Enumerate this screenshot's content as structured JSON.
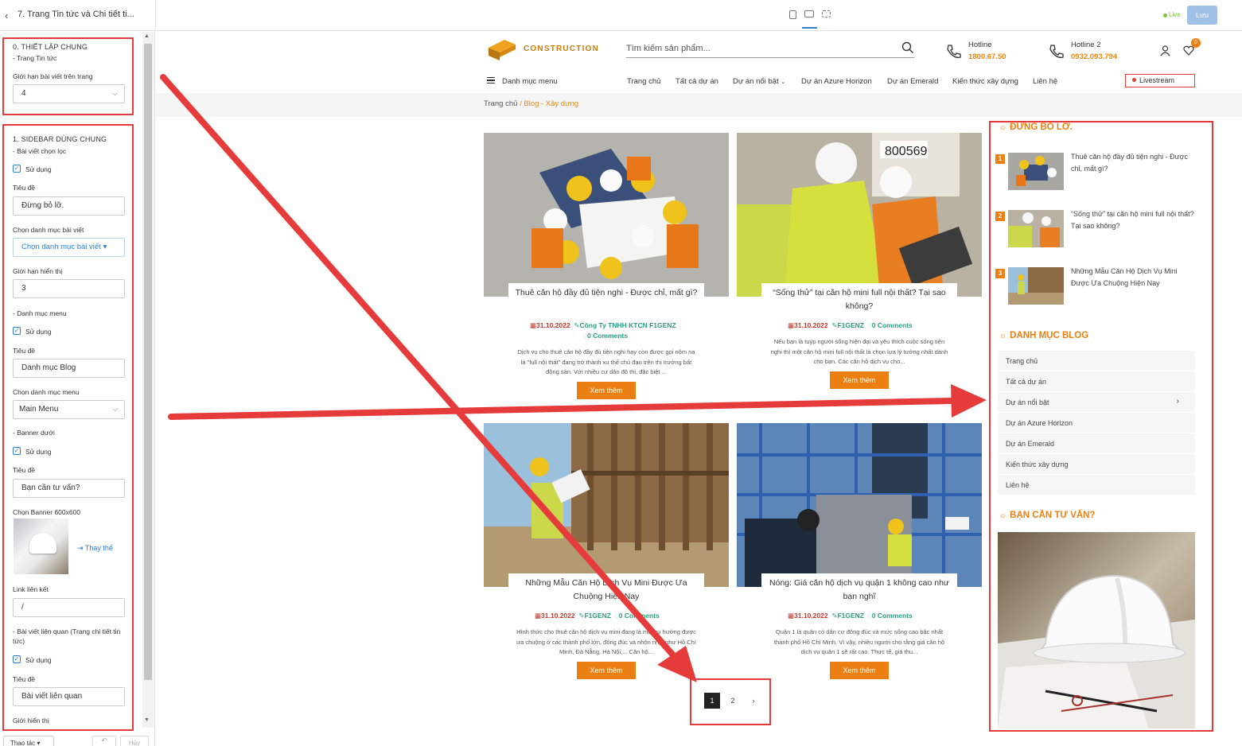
{
  "topbar": {
    "back_icon": "chevron-left-icon",
    "page_name": "7. Trang Tin tức và Chi tiết ti...",
    "devices": [
      "tablet-icon",
      "desktop-icon",
      "responsive-icon"
    ],
    "live_label": "Live",
    "save_label": "Lưu"
  },
  "panel": {
    "section0": {
      "title": "0. THIẾT LẬP CHUNG",
      "subtitle": "- Trang Tin tức",
      "limit_label": "Giới hạn bài viết trên trang",
      "limit_value": "4"
    },
    "section1": {
      "title": "1. SIDEBAR DÙNG CHUNG",
      "filtered_posts_label": "- Bài viết chọn lọc",
      "use_label": "Sử dụng",
      "title_label": "Tiêu đề",
      "title_value": "Đừng bỏ lỡ.",
      "category_label": "Chọn danh mục bài viết",
      "category_placeholder": "Chọn danh mục bài viết",
      "display_limit_label": "Giới hạn hiển thị",
      "display_limit_value": "3",
      "menu_cat_label": "- Danh mục menu",
      "menu_use_label": "Sử dụng",
      "menu_title_label": "Tiêu đề",
      "menu_title_value": "Danh mục Blog",
      "menu_choose_label": "Chọn danh mục menu",
      "menu_choose_value": "Main Menu",
      "banner_label": "- Banner dưới",
      "banner_use_label": "Sử dụng",
      "banner_title_label": "Tiêu đề",
      "banner_title_value": "Bạn cần tư vấn?",
      "banner_choose_label": "Chọn Banner 600x600",
      "replace_label": "Thay thế",
      "link_label": "Link liên kết",
      "link_value": "/",
      "related_label": "- Bài viết liên quan (Trang chi tiết tin tức)",
      "related_use_label": "Sử dụng",
      "related_title_label": "Tiêu đề",
      "related_title_value": "Bài viết liên quan",
      "related_limit_label": "Giới hiển thị"
    },
    "footer": {
      "actions_label": "Thao tác",
      "cancel_label": "Hủy"
    }
  },
  "site": {
    "logo_text": "CONSTRUCTION",
    "search_placeholder": "Tìm kiếm sản phẩm...",
    "hotline1_label": "Hotline",
    "hotline1_number": "1800.67.50",
    "hotline2_label": "Hotline 2",
    "hotline2_number": "0932.093.794",
    "cart_count": "0",
    "menu_label": "Danh mục menu",
    "nav": [
      "Trang chủ",
      "Tất cả dự án",
      "Dự án nổi bật",
      "Dự án Azure Horizon",
      "Dự án Emerald",
      "Kiến thức xây dựng",
      "Liên hệ"
    ],
    "livestream_label": "Livestream",
    "breadcrumb": {
      "home": "Trang chủ",
      "sep": "/",
      "current": "Blog - Xây dựng"
    }
  },
  "posts": [
    {
      "title": "Thuê căn hộ đầy đủ tiện nghi - Được chỉ, mất gì?",
      "date": "31.10.2022",
      "author": "Công Ty TNHH KTCN F1GENZ",
      "comments": "0 Comments",
      "excerpt": "Dịch vụ cho thuê căn hộ đầy đủ tiện nghi hay còn được gọi nôm na là \"full nội thất\" đang trở thành xu thế chủ đạo trên thị trường bất động sản. Với nhiều cư dân đô thị, đặc biệt ...",
      "more": "Xem thêm"
    },
    {
      "title": "“Sống thử” tại căn hộ mini full nội thất? Tại sao không?",
      "date": "31.10.2022",
      "author": "F1GENZ",
      "comments": "0 Comments",
      "excerpt": "Nếu bạn là tuýp người sống hiện đại và yêu thích cuộc sống tiện nghi thì một căn hộ mini full nội thất là chọn lựa lý tưởng nhất dành cho bạn. Các căn hộ dịch vụ cho...",
      "more": "Xem thêm"
    },
    {
      "title": "Những Mẫu Căn Hộ Dịch Vụ Mini Được Ưa Chuộng Hiện Nay",
      "date": "31.10.2022",
      "author": "F1GENZ",
      "comments": "0 Comments",
      "excerpt": "Hình thức cho thuê căn hộ dịch vụ mini đang là một xu hướng được ưa chuộng ở các thành phố lớn, đông đúc và nhộn nhịp như Hồ Chí Minh, Đà Nẵng, Hà Nội,... Căn hộ...",
      "more": "Xem thêm"
    },
    {
      "title": "Nóng: Giá căn hộ dịch vụ quận 1 không cao như bạn nghĩ",
      "date": "31.10.2022",
      "author": "F1GENZ",
      "comments": "0 Comments",
      "excerpt": "Quận 1 là quận có dân cư đông đúc và mức sống cao bậc nhất thành phố Hồ Chí Minh. Vì vậy, nhiều người cho rằng giá căn hộ dịch vụ quận 1 sẽ rất cao. Thực tế, giá thu...",
      "more": "Xem thêm"
    }
  ],
  "pagination": [
    "1",
    "2",
    "›"
  ],
  "sidebar": {
    "featured_title": "ĐỪNG BỎ LỠ.",
    "featured": [
      {
        "rank": "1",
        "title": "Thuê căn hộ đầy đủ tiện nghi - Được chỉ, mất gì?"
      },
      {
        "rank": "2",
        "title": "“Sống thử” tại căn hộ mini full nội thất? Tại sao không?"
      },
      {
        "rank": "3",
        "title": "Những Mẫu Căn Hộ Dịch Vụ Mini Được Ưa Chuộng Hiện Nay"
      }
    ],
    "blog_cat_title": "DANH MỤC BLOG",
    "categories": [
      "Trang chủ",
      "Tất cả dự án",
      "Dự án nổi bật",
      "Dự án Azure Horizon",
      "Dự án Emerald",
      "Kiến thức xây dựng",
      "Liên hệ"
    ],
    "consult_title": "BẠN CẦN TƯ VẤN?"
  },
  "colors": {
    "accent": "#ec7f11",
    "annotation": "#e53b3b",
    "link": "#2a7fd3"
  }
}
